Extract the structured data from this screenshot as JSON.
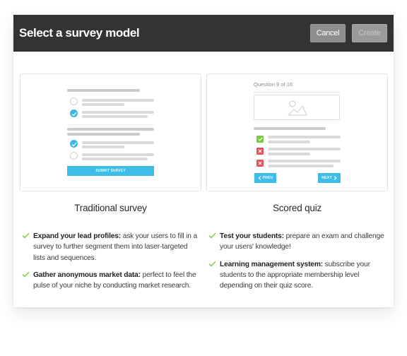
{
  "dialog": {
    "title": "Select a survey model",
    "cancel_label": "Cancel",
    "create_label": "Create",
    "create_disabled": true
  },
  "colors": {
    "header_bg": "#333333",
    "accent_blue": "#3dbde8",
    "check_green": "#7ac943",
    "cross_red": "#e5535a"
  },
  "options": [
    {
      "title": "Traditional survey",
      "preview": {
        "submit_label": "SUBMIT SURVEY",
        "questions": [
          {
            "options": [
              {
                "selected": false
              },
              {
                "selected": true
              }
            ]
          },
          {
            "options": [
              {
                "selected": true
              },
              {
                "selected": false
              }
            ]
          }
        ]
      },
      "features": [
        {
          "bold": "Expand your lead profiles:",
          "text": " ask your users to fill in a survey to further segment them into laser-targeted lists and sequences.",
          "icon": "check-icon"
        },
        {
          "bold": "Gather anonymous market data:",
          "text": " perfect to feel the pulse of your niche by conducting market research.",
          "icon": "check-icon"
        }
      ]
    },
    {
      "title": "Scored quiz",
      "preview": {
        "question_label": "Question 9 of 16",
        "answers": [
          {
            "state": "correct",
            "icon": "check-icon"
          },
          {
            "state": "wrong",
            "icon": "cross-icon"
          },
          {
            "state": "wrong",
            "icon": "cross-icon"
          }
        ],
        "prev_label": "PREV",
        "next_label": "NEXT"
      },
      "features": [
        {
          "bold": "Test your students:",
          "text": " prepare an exam and challenge your users' knowledge!",
          "icon": "check-icon"
        },
        {
          "bold": "Learning management system:",
          "text": " subscribe your students to the appropriate membership level depending on their quiz score.",
          "icon": "check-icon"
        }
      ]
    }
  ]
}
